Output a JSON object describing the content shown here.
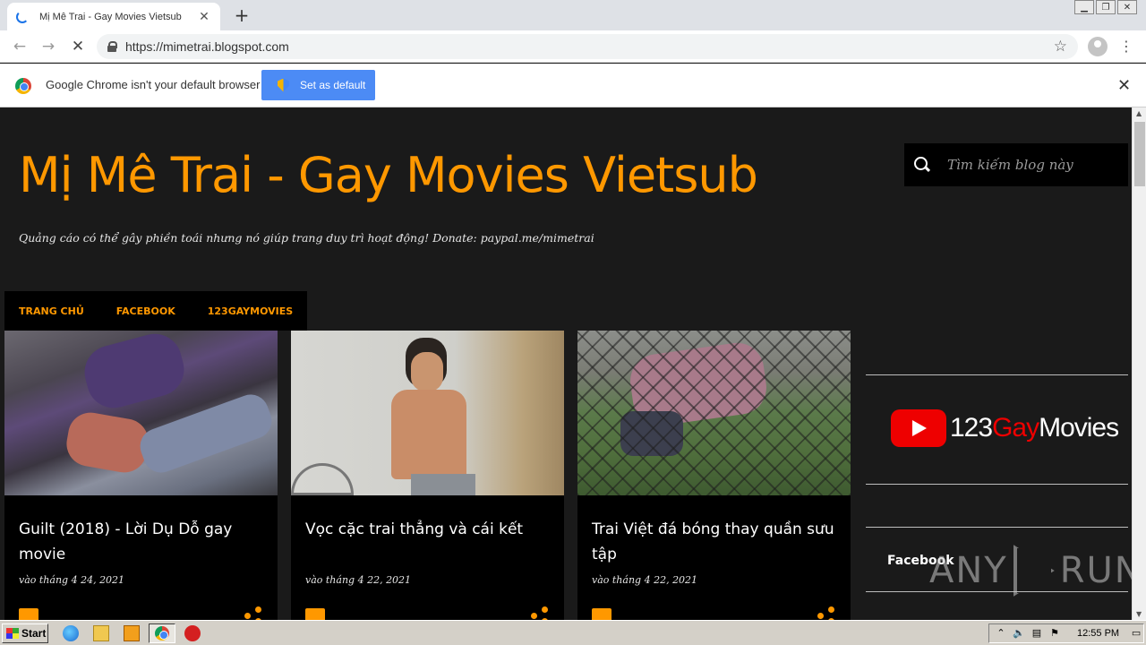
{
  "browser": {
    "tab_title": "Mị Mê Trai - Gay Movies Vietsub",
    "tab_close": "✕",
    "new_tab": "+",
    "url": "https://mimetrai.blogspot.com",
    "window_buttons": [
      "▁",
      "❐",
      "✕"
    ]
  },
  "infobar": {
    "message": "Google Chrome isn't your default browser",
    "button_label": "Set as default",
    "close": "✕"
  },
  "blog": {
    "title": "Mị Mê Trai - Gay Movies Vietsub",
    "description": "Quảng cáo có thể gây phiền toái nhưng nó giúp trang duy trì hoạt động! Donate: paypal.me/mimetrai",
    "search_placeholder": "Tìm kiếm blog này",
    "nav": [
      "TRANG CHỦ",
      "FACEBOOK",
      "123GAYMOVIES"
    ],
    "posts": [
      {
        "title": "Guilt (2018) - Lời Dụ Dỗ gay movie",
        "date": "vào tháng 4 24, 2021"
      },
      {
        "title": "Vọc cặc trai thẳng và cái kết",
        "date": "vào tháng 4 22, 2021"
      },
      {
        "title": "Trai Việt đá bóng thay quần sưu tập",
        "date": "vào tháng 4 22, 2021"
      }
    ],
    "sidebar": {
      "logo_text_1": "123",
      "logo_text_2": "Gay",
      "logo_text_3": "Movies",
      "facebook_label": "Facebook"
    }
  },
  "watermark": {
    "left": "ANY",
    "right": "RUN"
  },
  "taskbar": {
    "start_label": "Start",
    "clock": "12:55 PM"
  },
  "colors": {
    "accent": "#ff9800",
    "background": "#1a1a1a",
    "youtube_red": "#ee0000"
  }
}
